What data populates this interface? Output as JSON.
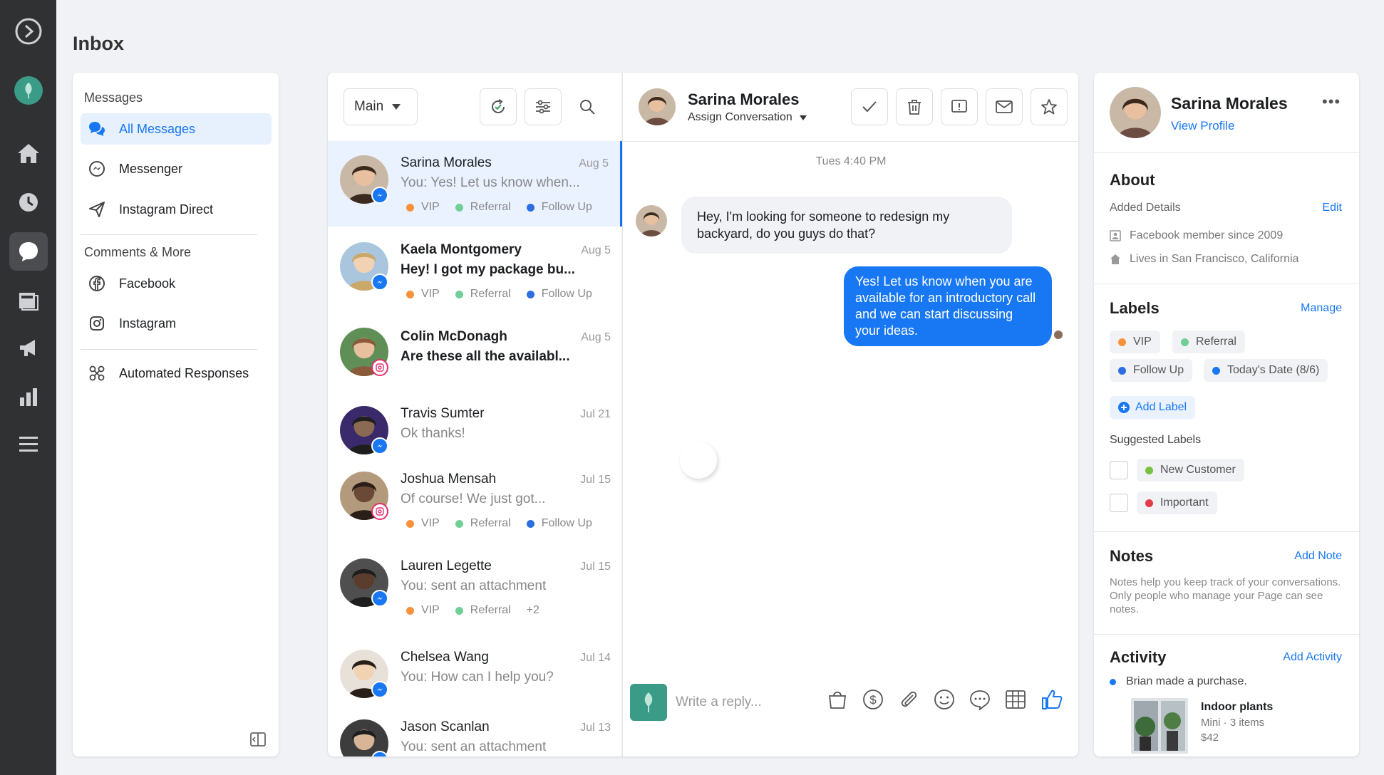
{
  "page": {
    "title": "Inbox"
  },
  "colors": {
    "accent": "#1877f2",
    "rail": "#2f3133",
    "vip": "#f7923a",
    "referral": "#6fcf97",
    "follow_up": "#2d6fe0",
    "new_customer": "#79c143",
    "important": "#e23b4a"
  },
  "rail": {
    "icons": [
      "meta-logo-icon",
      "profile-avatar-icon",
      "home-icon",
      "clock-icon",
      "inbox-icon",
      "pages-icon",
      "megaphone-icon",
      "insights-icon",
      "menu-icon"
    ]
  },
  "nav": {
    "messages_heading": "Messages",
    "items": [
      {
        "label": "All Messages",
        "icon": "chat-bubbles-icon"
      },
      {
        "label": "Messenger",
        "icon": "messenger-icon"
      },
      {
        "label": "Instagram Direct",
        "icon": "paper-plane-icon"
      }
    ],
    "comments_heading": "Comments & More",
    "comments_items": [
      {
        "label": "Facebook",
        "icon": "facebook-icon"
      },
      {
        "label": "Instagram",
        "icon": "instagram-icon"
      }
    ],
    "automated": "Automated Responses"
  },
  "list": {
    "filter_label": "Main",
    "rows": [
      {
        "name": "Sarina Morales",
        "date": "Aug 5",
        "preview": "You: Yes! Let us know when...",
        "unread": false,
        "source": "messenger",
        "tags": [
          "VIP",
          "Referral",
          "Follow Up"
        ]
      },
      {
        "name": "Kaela Montgomery",
        "date": "Aug 5",
        "preview": "Hey! I got my package bu...",
        "unread": true,
        "source": "messenger",
        "tags": [
          "VIP",
          "Referral",
          "Follow Up"
        ]
      },
      {
        "name": "Colin McDonagh",
        "date": "Aug 5",
        "preview": "Are these all the availabl...",
        "unread": true,
        "source": "instagram",
        "tags": []
      },
      {
        "name": "Travis Sumter",
        "date": "Jul 21",
        "preview": "Ok thanks!",
        "unread": false,
        "source": "messenger",
        "tags": []
      },
      {
        "name": "Joshua Mensah",
        "date": "Jul 15",
        "preview": "Of course! We just got...",
        "unread": false,
        "source": "instagram",
        "tags": [
          "VIP",
          "Referral",
          "Follow Up"
        ]
      },
      {
        "name": "Lauren Legette",
        "date": "Jul 15",
        "preview": "You: sent an attachment",
        "unread": false,
        "source": "messenger",
        "tags": [
          "VIP",
          "Referral",
          "+2"
        ]
      },
      {
        "name": "Chelsea Wang",
        "date": "Jul 14",
        "preview": "You: How can I help you?",
        "unread": false,
        "source": "messenger",
        "tags": []
      },
      {
        "name": "Jason Scanlan",
        "date": "Jul 13",
        "preview": "You: sent an attachment",
        "unread": false,
        "source": "messenger",
        "tags": []
      }
    ]
  },
  "conversation": {
    "name": "Sarina Morales",
    "assign": "Assign Conversation",
    "timestamp": "Tues 4:40 PM",
    "incoming": "Hey, I'm looking for someone to redesign my backyard, do you guys do that?",
    "outgoing": "Yes! Let us know when you are available for an introductory call and we can start discussing your ideas.",
    "reply_placeholder": "Write a reply..."
  },
  "profile": {
    "name": "Sarina Morales",
    "view_profile": "View Profile",
    "about_heading": "About",
    "added_details": "Added Details",
    "edit": "Edit",
    "member_since": "Facebook member since 2009",
    "lives_in": "Lives in San Francisco, California",
    "labels_heading": "Labels",
    "manage": "Manage",
    "labels": [
      "VIP",
      "Referral",
      "Follow Up",
      "Today's Date (8/6)"
    ],
    "add_label": "Add Label",
    "suggested_heading": "Suggested Labels",
    "suggested": [
      "New Customer",
      "Important"
    ],
    "notes_heading": "Notes",
    "add_note": "Add Note",
    "notes_help": "Notes help you keep track of your conversations. Only people who manage your Page can see notes.",
    "activity_heading": "Activity",
    "add_activity": "Add Activity",
    "activity_text": "Brian made a purchase.",
    "product_name": "Indoor plants",
    "product_meta": "Mini · 3 items",
    "product_price": "$42"
  }
}
